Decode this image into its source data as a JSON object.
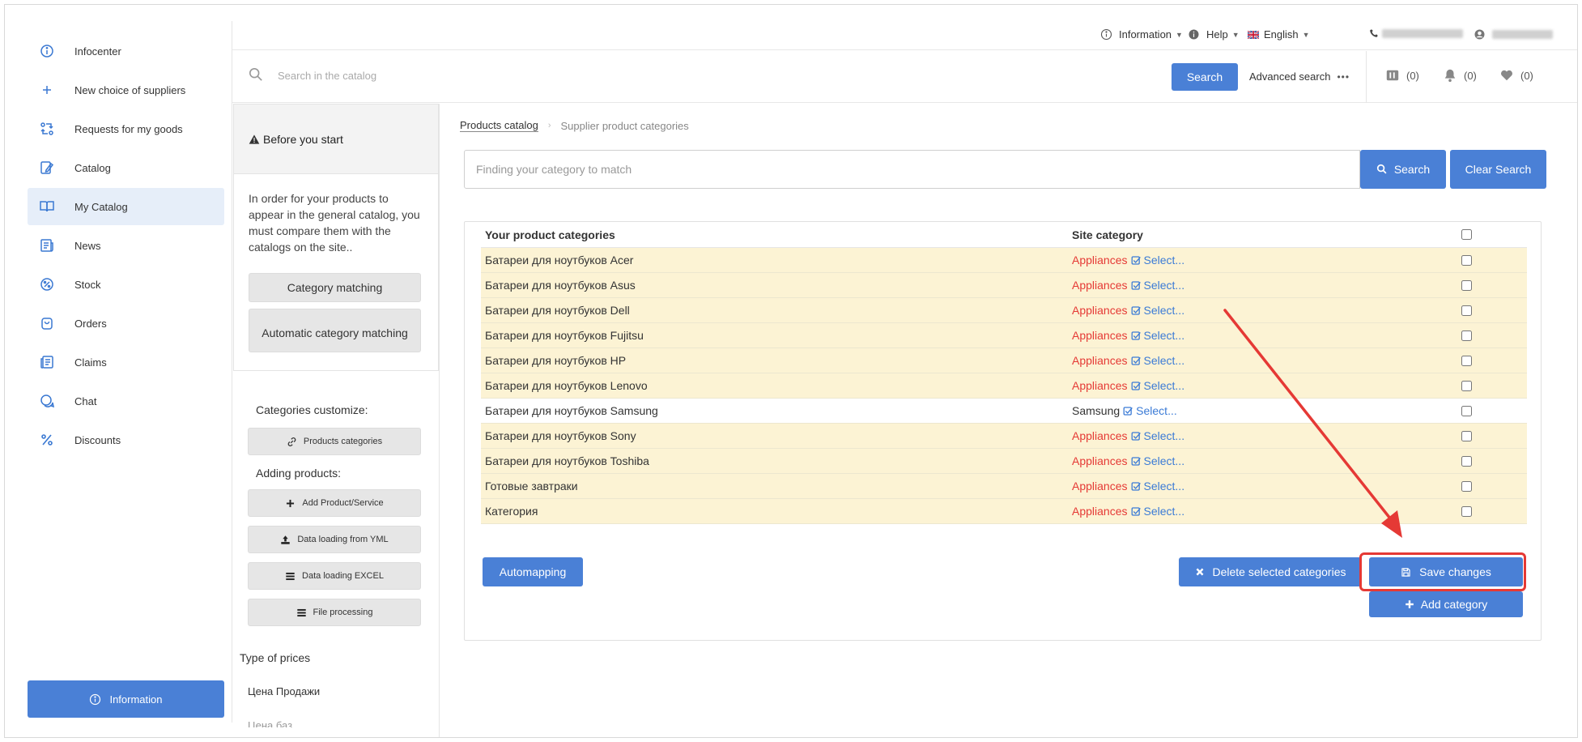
{
  "sidebar": {
    "items": [
      {
        "label": "Infocenter",
        "icon": "info-circle-icon"
      },
      {
        "label": "New choice of suppliers",
        "icon": "plus-icon"
      },
      {
        "label": "Requests for my goods",
        "icon": "exchange-icon"
      },
      {
        "label": "Catalog",
        "icon": "catalog-icon"
      },
      {
        "label": "My Catalog",
        "icon": "book-icon",
        "active": true
      },
      {
        "label": "News",
        "icon": "news-icon"
      },
      {
        "label": "Stock",
        "icon": "percent-badge-icon"
      },
      {
        "label": "Orders",
        "icon": "bag-icon"
      },
      {
        "label": "Claims",
        "icon": "claims-icon"
      },
      {
        "label": "Chat",
        "icon": "chat-icon"
      },
      {
        "label": "Discounts",
        "icon": "percent-icon"
      }
    ],
    "info_button": "Information"
  },
  "topbar": {
    "information": "Information",
    "help": "Help",
    "language": "English"
  },
  "search": {
    "placeholder": "Search in the catalog",
    "button": "Search",
    "advanced": "Advanced search",
    "advanced_dots": "•••"
  },
  "counters": {
    "compare": "(0)",
    "notifications": "(0)",
    "favorites": "(0)"
  },
  "before": {
    "title": "Before you start",
    "text": "In order for your products to appear in the general catalog, you must compare them with the catalogs on the site..",
    "category_matching": "Category matching",
    "auto_matching": "Automatic category matching"
  },
  "side": {
    "customize_label": "Categories customize:",
    "products_categories": "Products categories",
    "adding_label": "Adding products:",
    "add_product": "Add Product/Service",
    "yml": "Data loading from YML",
    "excel": "Data loading EXCEL",
    "file_processing": "File processing",
    "type_prices": "Type of prices",
    "price_sale": "Цена Продажи",
    "price_cut": "Цена баз"
  },
  "breadcrumb": {
    "products_catalog": "Products catalog",
    "separator": "›",
    "current": "Supplier product categories"
  },
  "main": {
    "category_search_placeholder": "Finding your category to match",
    "search_button": "Search",
    "clear_button": "Clear Search",
    "headers": {
      "your_categories": "Your product categories",
      "site_category": "Site category"
    },
    "select_label": "Select...",
    "rows": [
      {
        "name": "Батареи для ноутбуков Acer",
        "site": "Appliances",
        "matched": false
      },
      {
        "name": "Батареи для ноутбуков Asus",
        "site": "Appliances",
        "matched": false
      },
      {
        "name": "Батареи для ноутбуков Dell",
        "site": "Appliances",
        "matched": false
      },
      {
        "name": "Батареи для ноутбуков Fujitsu",
        "site": "Appliances",
        "matched": false
      },
      {
        "name": "Батареи для ноутбуков HP",
        "site": "Appliances",
        "matched": false
      },
      {
        "name": "Батареи для ноутбуков Lenovo",
        "site": "Appliances",
        "matched": false
      },
      {
        "name": "Батареи для ноутбуков Samsung",
        "site": "Samsung",
        "matched": true
      },
      {
        "name": "Батареи для ноутбуков Sony",
        "site": "Appliances",
        "matched": false
      },
      {
        "name": "Батареи для ноутбуков Toshiba",
        "site": "Appliances",
        "matched": false
      },
      {
        "name": "Готовые завтраки",
        "site": "Appliances",
        "matched": false
      },
      {
        "name": "Категория",
        "site": "Appliances",
        "matched": false
      }
    ],
    "automapping": "Automapping",
    "delete_selected": "Delete selected categories",
    "save_changes": "Save changes",
    "add_category": "Add category"
  },
  "colors": {
    "accent": "#4a80d6",
    "highlight_row": "#fcf3d4",
    "unmatched_text": "#e53935",
    "annotation": "#e53935"
  }
}
